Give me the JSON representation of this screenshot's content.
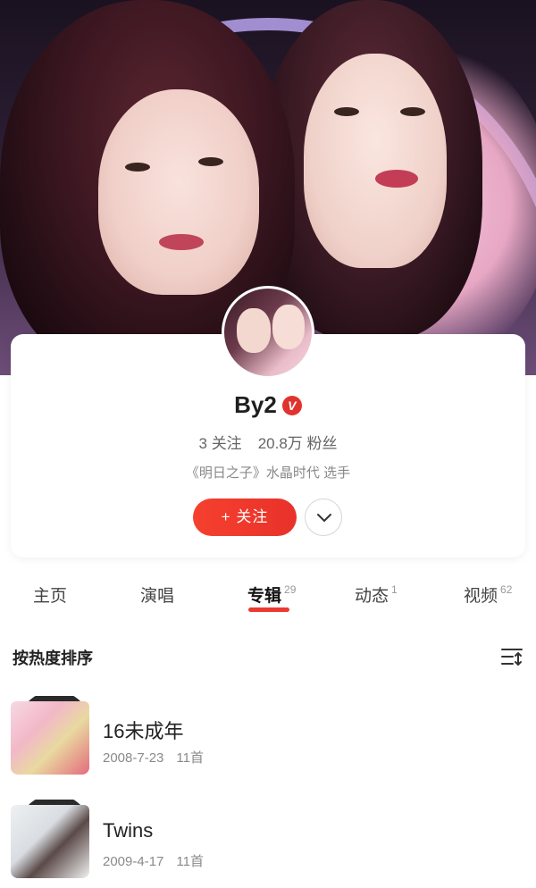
{
  "profile": {
    "name": "By2",
    "verified_badge": "V",
    "following_count": "3",
    "following_label": "关注",
    "fans_count": "20.8万",
    "fans_label": "粉丝",
    "description": "《明日之子》水晶时代 选手",
    "follow_button": "+ 关注"
  },
  "tabs": [
    {
      "label": "主页",
      "count": ""
    },
    {
      "label": "演唱",
      "count": ""
    },
    {
      "label": "专辑",
      "count": "29",
      "active": true
    },
    {
      "label": "动态",
      "count": "1"
    },
    {
      "label": "视频",
      "count": "62"
    }
  ],
  "sort": {
    "label": "按热度排序",
    "icon": "sort-order-icon"
  },
  "albums": [
    {
      "title": "16未成年",
      "date": "2008-7-23",
      "tracks": "11首"
    },
    {
      "title": "Twins",
      "date": "2009-4-17",
      "tracks": "11首"
    }
  ],
  "colors": {
    "accent": "#E8322A",
    "text_primary": "#222222",
    "text_secondary": "#8A8A8A"
  }
}
